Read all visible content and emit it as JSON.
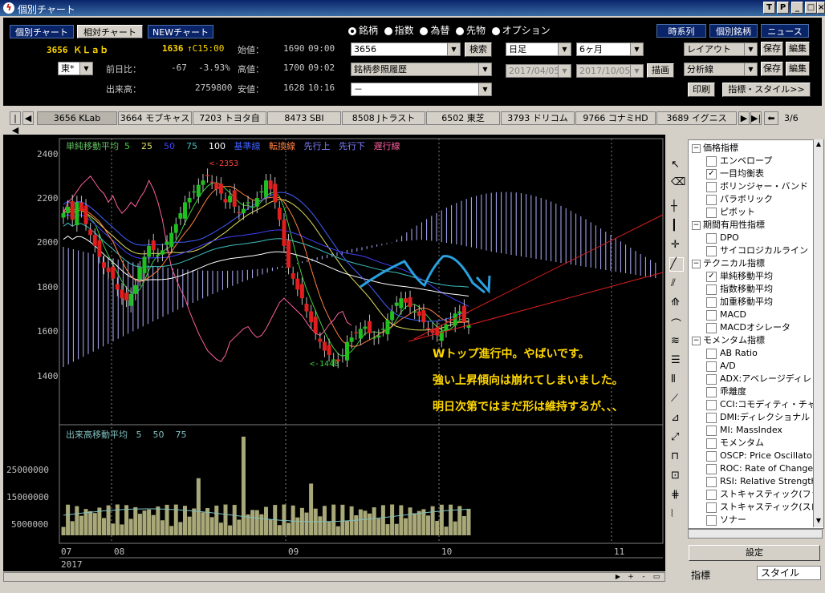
{
  "window": {
    "title": "個別チャート"
  },
  "nav": {
    "individual": "個別チャート",
    "relative": "相対チャート",
    "new_chart": "NEWチャート"
  },
  "stock": {
    "code_name": "3656 ＫＬａｂ",
    "price": "1636",
    "price_mark": "↑C15:00",
    "open_label": "始値：",
    "open_val": "1690",
    "open_time": "09:00",
    "market": "東*",
    "change_label": "前日比：",
    "change_val": "-67",
    "change_pct": "-3.93%",
    "high_label": "高値：",
    "high_val": "1700",
    "high_time": "09:02",
    "volume_label": "出来高：",
    "volume_val": "2759800",
    "low_label": "安値：",
    "low_val": "1628",
    "low_time": "10:16"
  },
  "asset_types": [
    "銘柄",
    "指数",
    "為替",
    "先物",
    "オプション"
  ],
  "search": {
    "code_value": "3656",
    "search_label": "検索",
    "history_value": "銘柄参照履歴",
    "third_value": "－"
  },
  "period": {
    "interval": "日足",
    "range": "6ヶ月",
    "from": "2017/04/05",
    "to": "2017/10/05",
    "draw_label": "描画"
  },
  "right_buttons": {
    "timeseries": "時系列",
    "individual": "個別銘柄",
    "news": "ニュース",
    "layout": "レイアウト",
    "save": "保存",
    "edit": "編集",
    "analysis": "分析線",
    "print": "印刷",
    "indicator_style": "指標・スタイル>>"
  },
  "tabs": [
    "3656 KLab",
    "3664 モブキャス",
    "7203 トヨタ自",
    "8473 SBI",
    "8508 Jトラスト",
    "6502 東芝",
    "3793 ドリコム",
    "9766 コナミHD",
    "3689 イグニス"
  ],
  "tab_page": "3/6",
  "legend": {
    "sma": "単純移動平均",
    "p5": "5",
    "p25": "25",
    "p50": "50",
    "p75": "75",
    "p100": "100",
    "kijun": "基準線",
    "tenkan": "転換線",
    "senko_up": "先行上",
    "senko_down": "先行下",
    "chikou": "遅行線"
  },
  "annotations": {
    "high_mark": "<-2353",
    "low_mark": "<-1448",
    "note1": "Wトップ進行中。やばいです。",
    "note2": "強い上昇傾向は崩れてしまいました。",
    "note3": "明日次第ではまだ形は維持するが、、、"
  },
  "volume_legend": {
    "label": "出来高移動平均",
    "p5": "5",
    "p50": "50",
    "p75": "75"
  },
  "price_axis": [
    "2400",
    "2200",
    "2000",
    "1800",
    "1600",
    "1400"
  ],
  "volume_axis": [
    "25000000",
    "15000000",
    "5000000"
  ],
  "x_axis": {
    "m07": "07",
    "m08": "08",
    "m09": "09",
    "m10": "10",
    "m11": "11",
    "year": "2017"
  },
  "tree": {
    "groups": [
      {
        "label": "価格指標",
        "items": [
          {
            "label": "エンベロープ",
            "checked": false
          },
          {
            "label": "一目均衡表",
            "checked": true
          },
          {
            "label": "ボリンジャー・バンド",
            "checked": false
          },
          {
            "label": "パラボリック",
            "checked": false
          },
          {
            "label": "ピボット",
            "checked": false
          }
        ]
      },
      {
        "label": "期間有用性指標",
        "items": [
          {
            "label": "DPO",
            "checked": false
          },
          {
            "label": "サイコロジカルライン",
            "checked": false
          }
        ]
      },
      {
        "label": "テクニカル指標",
        "items": [
          {
            "label": "単純移動平均",
            "checked": true
          },
          {
            "label": "指数移動平均",
            "checked": false
          },
          {
            "label": "加重移動平均",
            "checked": false
          },
          {
            "label": "MACD",
            "checked": false
          },
          {
            "label": "MACDオシレータ",
            "checked": false
          }
        ]
      },
      {
        "label": "モメンタム指標",
        "items": [
          {
            "label": "AB Ratio",
            "checked": false
          },
          {
            "label": "A/D",
            "checked": false
          },
          {
            "label": "ADX:アベレージディレ",
            "checked": false
          },
          {
            "label": "乖離度",
            "checked": false
          },
          {
            "label": "CCI:コモディティ・チャ",
            "checked": false
          },
          {
            "label": "DMI:ディレクショナル",
            "checked": false
          },
          {
            "label": "MI: MassIndex",
            "checked": false
          },
          {
            "label": "モメンタム",
            "checked": false
          },
          {
            "label": "OSCP: Price Oscillato",
            "checked": false
          },
          {
            "label": "ROC: Rate of Change",
            "checked": false
          },
          {
            "label": "RSI: Relative Strength",
            "checked": false
          },
          {
            "label": "ストキャスティック(ファ",
            "checked": false
          },
          {
            "label": "ストキャスティック(スロ",
            "checked": false
          },
          {
            "label": "ソナー",
            "checked": false
          }
        ]
      }
    ]
  },
  "settings_button": "設定",
  "bottom_tabs": {
    "indicator": "指標",
    "style": "スタイル"
  },
  "colors": {
    "up": "#1fbf1f",
    "down": "#e01e1e",
    "cloud": "#b0b0ff",
    "note": "#ffd700",
    "arrow": "#2aa0e0"
  }
}
